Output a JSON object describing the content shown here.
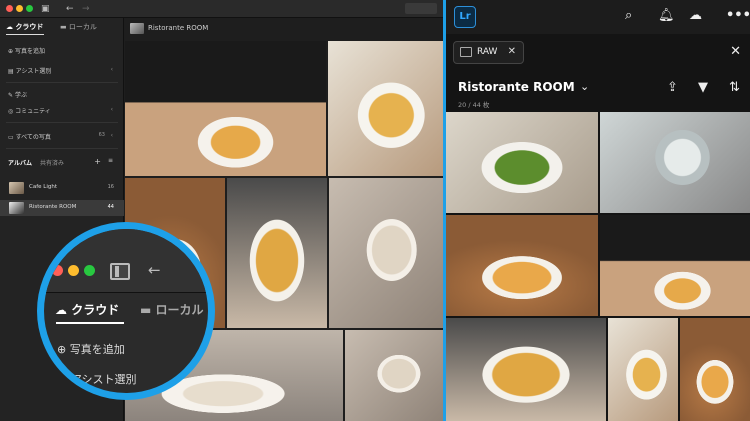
{
  "left_app": {
    "sidebar": {
      "tab_cloud": "クラウド",
      "tab_local": "ローカル",
      "items": [
        {
          "label": "写真を追加"
        },
        {
          "label": "アシスト選別"
        },
        {
          "label": "学ぶ"
        },
        {
          "label": "コミュニティ"
        },
        {
          "label": "すべての写真",
          "count": "63"
        }
      ],
      "albums_tab": "アルバム",
      "shared_tab": "共有済み",
      "albums": [
        {
          "label": "Cafe Light",
          "count": "16"
        },
        {
          "label": "Ristorante ROOM",
          "count": "44"
        }
      ]
    },
    "main": {
      "album_title": "Ristorante ROOM"
    },
    "zoom_callout": {
      "tab_cloud": "クラウド",
      "tab_local": "ローカル",
      "add_photos": "写真を追加",
      "assisted_culling": "アシスト選別"
    }
  },
  "right_app": {
    "logo": "Lr",
    "filter_chip": "RAW",
    "album_title": "Ristorante ROOM",
    "photo_count": "20 / 44 枚"
  },
  "colors": {
    "accent_blue": "#1ea0e8",
    "lr_blue": "#31a8ff"
  }
}
